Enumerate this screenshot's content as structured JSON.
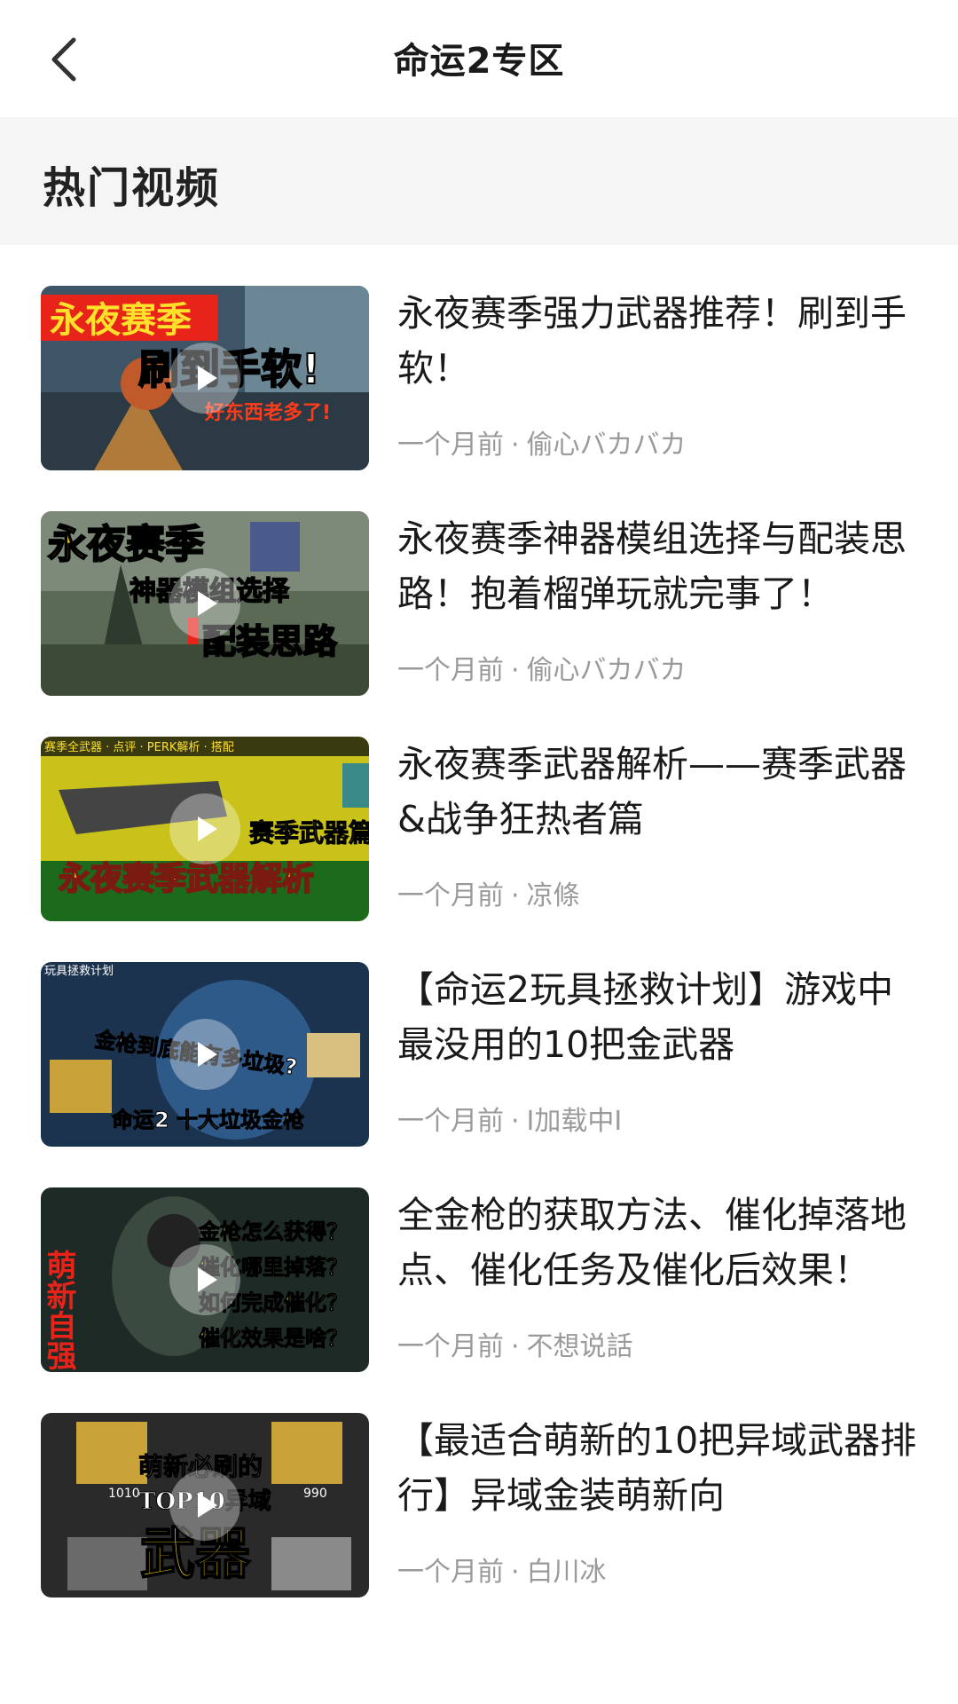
{
  "header": {
    "title": "命运2专区"
  },
  "section": {
    "title": "热门视频"
  },
  "videos": [
    {
      "title": "永夜赛季强力武器推荐！刷到手软！",
      "time": "一个月前",
      "author": "偷心バカバカ",
      "thumb_text": [
        "永夜赛季",
        "刷到手软!",
        "好东西老多了!"
      ],
      "colors": {
        "bg": "#3d5566",
        "accent": "#e8231a"
      }
    },
    {
      "title": "永夜赛季神器模组选择与配装思路！抱着榴弹玩就完事了！",
      "time": "一个月前",
      "author": "偷心バカバカ",
      "thumb_text": [
        "永夜赛季",
        "神器模组选择",
        "配装思路"
      ],
      "colors": {
        "bg": "#5a6a55",
        "accent": "#f2c21b"
      }
    },
    {
      "title": "永夜赛季武器解析——赛季武器&战争狂热者篇",
      "time": "一个月前",
      "author": "凉條",
      "thumb_text": [
        "赛季全武器 · 点评 · PERK解析 · 搭配",
        "赛季武器篇",
        "永夜赛季武器解析"
      ],
      "colors": {
        "bg": "#c9c21a",
        "accent": "#1a1a1a"
      }
    },
    {
      "title": "【命运2玩具拯救计划】游戏中最没用的10把金武器",
      "time": "一个月前",
      "author": "I加载中I",
      "thumb_text": [
        "玩具拯救计划",
        "金枪到底能有多垃圾?",
        "命运2 十大垃圾金枪"
      ],
      "colors": {
        "bg": "#1c3350",
        "accent": "#f2a31b"
      }
    },
    {
      "title": "全金枪的获取方法、催化掉落地点、催化任务及催化后效果！",
      "time": "一个月前",
      "author": "不想说話",
      "thumb_text": [
        "萌新自强",
        "金枪怎么获得？",
        "催化哪里掉落？",
        "如何完成催化？",
        "催化效果是啥？"
      ],
      "colors": {
        "bg": "#1e2a26",
        "accent": "#f7e01a"
      }
    },
    {
      "title": "【最适合萌新的10把异域武器排行】异域金装萌新向",
      "time": "一个月前",
      "author": "白川冰",
      "thumb_text": [
        "萌新必刷的",
        "TOP10异域",
        "武器",
        "1010",
        "990"
      ],
      "colors": {
        "bg": "#2a2a2a",
        "accent": "#f2d21b"
      }
    }
  ]
}
